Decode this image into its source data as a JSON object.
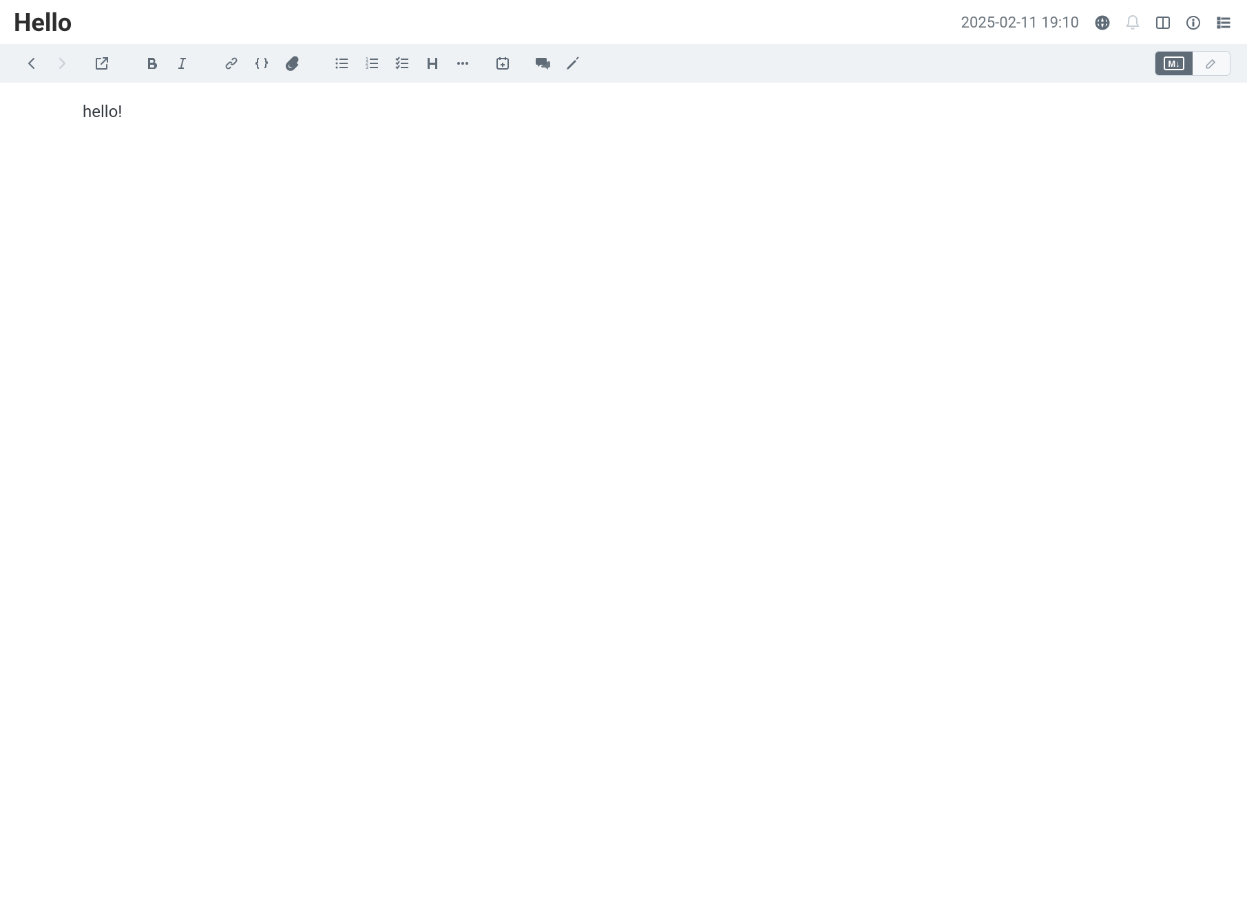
{
  "header": {
    "title": "Hello",
    "timestamp": "2025-02-11 19:10",
    "icons": {
      "language": "language-icon",
      "notifications": "bell-icon",
      "split_view": "split-view-icon",
      "info": "info-icon",
      "outline": "outline-icon"
    }
  },
  "toolbar": {
    "nav_back": "chevron-left-icon",
    "nav_forward": "chevron-right-icon",
    "open_external": "external-link-icon",
    "bold": "bold-icon",
    "italic": "italic-icon",
    "link": "link-icon",
    "code": "code-braces-icon",
    "attachment": "paperclip-icon",
    "unordered_list": "bullet-list-icon",
    "ordered_list": "ordered-list-icon",
    "task_list": "task-list-icon",
    "heading": "heading-icon",
    "more": "more-icon",
    "insert_date": "calendar-plus-icon",
    "comments": "comments-icon",
    "highlight": "highlighter-icon",
    "mode_markdown_label": "M↓",
    "mode_markdown_active": true,
    "mode_edit": "edit-icon"
  },
  "content": {
    "body": "hello!"
  }
}
